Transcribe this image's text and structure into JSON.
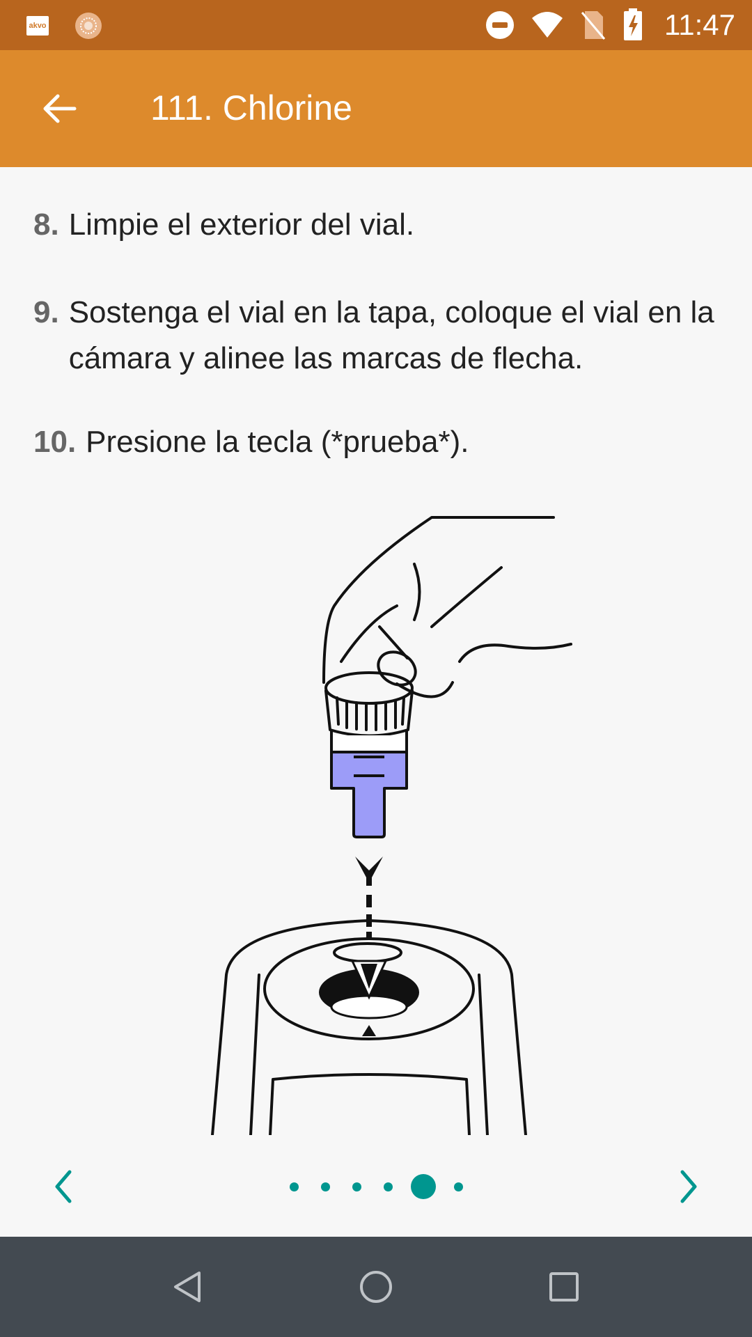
{
  "status_bar": {
    "time": "11:47",
    "icons": [
      "akvo-app-icon",
      "sun-icon",
      "do-not-disturb-icon",
      "wifi-icon",
      "no-sim-icon",
      "battery-charging-icon"
    ],
    "app_label": "akvo"
  },
  "app_bar": {
    "title": "111. Chlorine",
    "back_icon": "arrow-back-icon"
  },
  "steps": [
    {
      "num": "8.",
      "text": "Limpie el exterior del vial."
    },
    {
      "num": "9.",
      "text": "Sostenga el vial en la tapa, coloque el vial en la cámara y alinee las marcas de flecha."
    },
    {
      "num": "10.",
      "text": "Presione la tecla (*prueba*)."
    }
  ],
  "illustration": {
    "icon": "vial-insertion-illustration",
    "liquid_color": "#9c9cf8"
  },
  "pager": {
    "prev_icon": "chevron-left-icon",
    "next_icon": "chevron-right-icon",
    "page_count": 6,
    "current_page": 5,
    "accent_color": "#00968f"
  },
  "nav_bar": {
    "icons": [
      "back-triangle-icon",
      "home-circle-icon",
      "recents-square-icon"
    ]
  }
}
